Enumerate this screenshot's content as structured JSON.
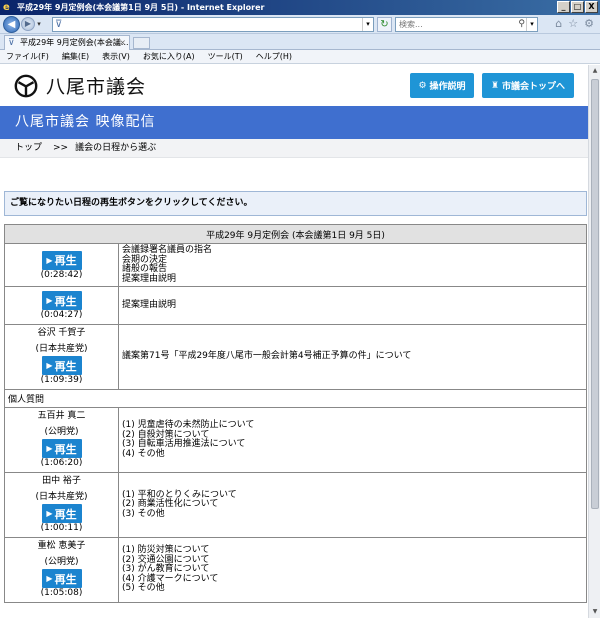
{
  "window": {
    "title": "平成29年 9月定例会(本会議第1日 9月 5日) - Internet Explorer",
    "buttons": {
      "minimize": "_",
      "maximize": "□",
      "close": "X"
    }
  },
  "browser": {
    "search_placeholder": "検索...",
    "tab_title": "平成29年 9月定例会(本会議...",
    "tab_close": "×",
    "menu": [
      "ファイル(F)",
      "編集(E)",
      "表示(V)",
      "お気に入り(A)",
      "ツール(T)",
      "ヘルプ(H)"
    ]
  },
  "site": {
    "name": "八尾市議会",
    "manual_button": "操作説明",
    "top_button": "市議会トップへ",
    "banner": "八尾市議会  映像配信",
    "breadcrumb": {
      "top": "トップ",
      "sep": ">>",
      "current": "議会の日程から選ぶ"
    },
    "notice": "ご覧になりたい日程の再生ボタンをクリックしてください。"
  },
  "schedule": {
    "header": "平成29年 9月定例会 (本会議第1日 9月 5日)",
    "play_label": "再生",
    "section_individual": "個人質問",
    "rows": [
      {
        "speaker": "",
        "party": "",
        "duration": "(0:28:42)",
        "items": [
          "会議録署名議員の指名",
          "会期の決定",
          "諸般の報告",
          "提案理由説明"
        ]
      },
      {
        "speaker": "",
        "party": "",
        "duration": "(0:04:27)",
        "items": [
          "提案理由説明"
        ]
      },
      {
        "speaker": "谷沢  千賀子",
        "party": "(日本共産党)",
        "duration": "(1:09:39)",
        "items": [
          "議案第71号「平成29年度八尾市一般会計第4号補正予算の件」について"
        ]
      }
    ],
    "individual_rows": [
      {
        "speaker": "五百井  真二",
        "party": "(公明党)",
        "duration": "(1:06:20)",
        "items": [
          "(1) 児童虐待の未然防止について",
          "(2) 自殺対策について",
          "(3) 自転車活用推進法について",
          "(4) その他"
        ]
      },
      {
        "speaker": "田中  裕子",
        "party": "(日本共産党)",
        "duration": "(1:00:11)",
        "items": [
          "(1) 平和のとりくみについて",
          "(2) 商業活性化について",
          "(3) その他"
        ]
      },
      {
        "speaker": "重松  恵美子",
        "party": "(公明党)",
        "duration": "(1:05:08)",
        "items": [
          "(1) 防災対策について",
          "(2) 交通公園について",
          "(3) がん教育について",
          "(4) 介護マークについて",
          "(5) その他"
        ]
      }
    ]
  },
  "colors": {
    "banner": "#3f6fcf",
    "button": "#1f95d6",
    "play": "#1b84cf",
    "notice_bg": "#eaf0f9",
    "table_header": "#e1e1e1"
  }
}
